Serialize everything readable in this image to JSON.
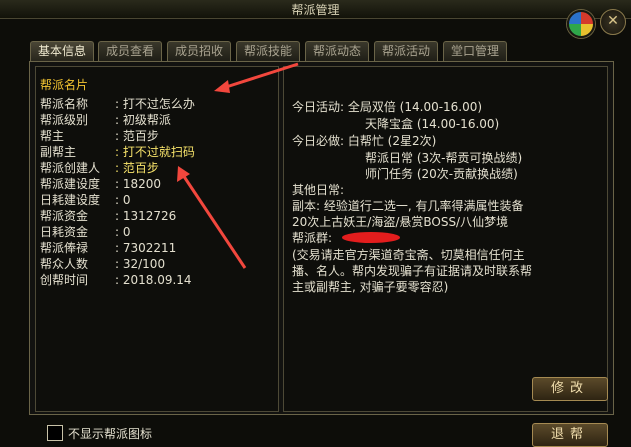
{
  "window": {
    "title": "帮派管理"
  },
  "tabs": [
    {
      "label": "基本信息"
    },
    {
      "label": "成员查看"
    },
    {
      "label": "成员招收"
    },
    {
      "label": "帮派技能"
    },
    {
      "label": "帮派动态"
    },
    {
      "label": "帮派活动"
    },
    {
      "label": "堂口管理"
    }
  ],
  "info": {
    "heading": "帮派名片",
    "rows": [
      {
        "label": "帮派名称",
        "value": "打不过怎么办"
      },
      {
        "label": "帮派级别",
        "value": "初级帮派"
      },
      {
        "label": "帮主",
        "value": "范百步"
      },
      {
        "label": "副帮主",
        "value": "打不过就扫码"
      },
      {
        "label": "帮派创建人",
        "value": "范百步"
      },
      {
        "label": "帮派建设度",
        "value": "18200"
      },
      {
        "label": "日耗建设度",
        "value": "0"
      },
      {
        "label": "帮派资金",
        "value": "1312726"
      },
      {
        "label": "日耗资金",
        "value": "0"
      },
      {
        "label": "帮派俸禄",
        "value": "7302211"
      },
      {
        "label": "帮众人数",
        "value": "32/100"
      },
      {
        "label": "创帮时间",
        "value": "2018.09.14"
      }
    ]
  },
  "notice": {
    "l1": "今日活动: 全局双倍 (14.00-16.00)",
    "l2": "天降宝盒 (14.00-16.00)",
    "l3": "今日必做: 白帮忙 (2星2次)",
    "l4": "帮派日常 (3次-帮贡可换战绩)",
    "l5": "师门任务 (20次-贡献换战绩)",
    "l6": "其他日常:",
    "l7": "副本: 经验道行二选一, 有几率得满属性装备",
    "l8": "20次上古妖王/海盗/悬赏BOSS/八仙梦境",
    "l9": "帮派群:",
    "l10": "(交易请走官方渠道奇宝斋、切莫相信任何主",
    "l11": "播、名人。帮内发现骗子有证据请及时联系帮",
    "l12": "主或副帮主, 对骗子要零容忍)"
  },
  "buttons": {
    "modify": "修改",
    "exit": "退帮"
  },
  "footer": {
    "checkbox_label": "不显示帮派图标"
  },
  "colors": {
    "heading": "#f4c531",
    "highlight": "#f6e26a",
    "arrow": "#f2473d",
    "redaction": "#e31d1d"
  }
}
